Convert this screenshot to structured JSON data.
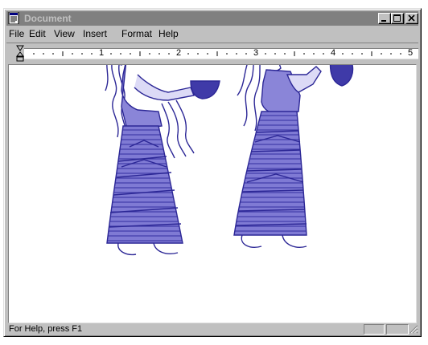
{
  "window": {
    "title": "Document"
  },
  "menu": [
    "File",
    "Edit",
    "View",
    "Insert",
    "Format",
    "Help"
  ],
  "ruler": {
    "numbers": [
      "1",
      "2",
      "3",
      "4",
      "5"
    ]
  },
  "status": {
    "text": "For Help, press F1"
  },
  "colors": {
    "titlebar_inactive": "#808080",
    "figure_blue": "#3f3aa8",
    "figure_fill": "#7f7ad4"
  }
}
